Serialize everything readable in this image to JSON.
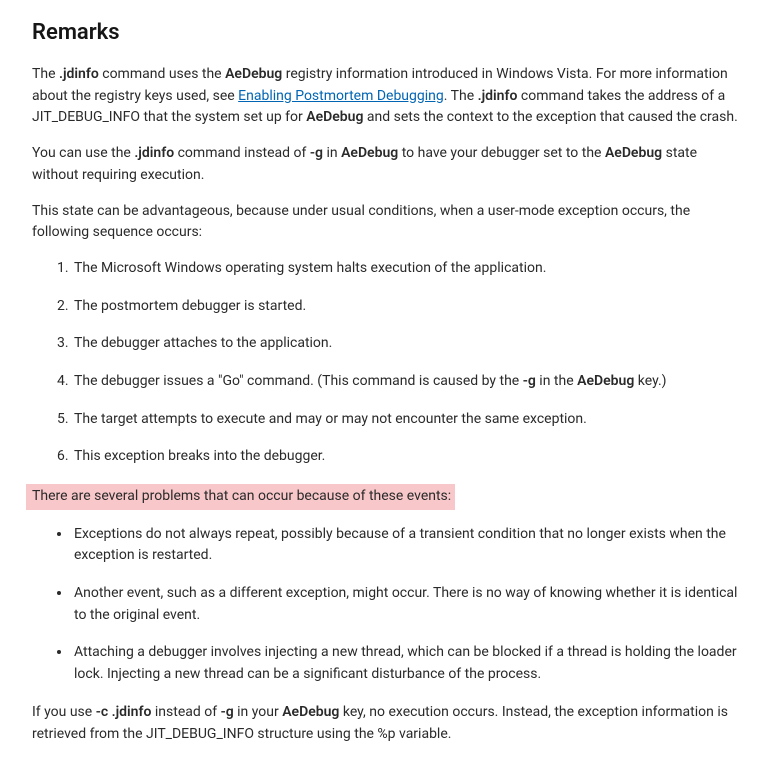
{
  "heading": "Remarks",
  "p1": {
    "t1": "The ",
    "b1": ".jdinfo",
    "t2": " command uses the ",
    "b2": "AeDebug",
    "t3": " registry information introduced in Windows Vista. For more information about the registry keys used, see ",
    "link": "Enabling Postmortem Debugging",
    "t4": ". The ",
    "b3": ".jdinfo",
    "t5": " command takes the address of a JIT_DEBUG_INFO that the system set up for ",
    "b4": "AeDebug",
    "t6": " and sets the context to the exception that caused the crash."
  },
  "p2": {
    "t1": "You can use the ",
    "b1": ".jdinfo",
    "t2": " command instead of ",
    "b2": "-g",
    "t3": " in ",
    "b3": "AeDebug",
    "t4": " to have your debugger set to the ",
    "b4": "AeDebug",
    "t5": " state without requiring execution."
  },
  "p3": "This state can be advantageous, because under usual conditions, when a user-mode exception occurs, the following sequence occurs:",
  "ol": {
    "i1": "The Microsoft Windows operating system halts execution of the application.",
    "i2": "The postmortem debugger is started.",
    "i3": "The debugger attaches to the application.",
    "i4": {
      "t1": "The debugger issues a \"Go\" command. (This command is caused by the ",
      "b1": "-g",
      "t2": " in the ",
      "b2": "AeDebug",
      "t3": " key.)"
    },
    "i5": "The target attempts to execute and may or may not encounter the same exception.",
    "i6": "This exception breaks into the debugger."
  },
  "p4": "There are several problems that can occur because of these events:",
  "ul": {
    "i1": "Exceptions do not always repeat, possibly because of a transient condition that no longer exists when the exception is restarted.",
    "i2": "Another event, such as a different exception, might occur. There is no way of knowing whether it is identical to the original event.",
    "i3": "Attaching a debugger involves injecting a new thread, which can be blocked if a thread is holding the loader lock. Injecting a new thread can be a significant disturbance of the process."
  },
  "p5": {
    "t1": "If you use ",
    "b1": "-c .jdinfo",
    "t2": " instead of ",
    "b2": "-g",
    "t3": " in your ",
    "b3": "AeDebug",
    "t4": " key, no execution occurs. Instead, the exception information is retrieved from the JIT_DEBUG_INFO structure using the %p variable."
  }
}
